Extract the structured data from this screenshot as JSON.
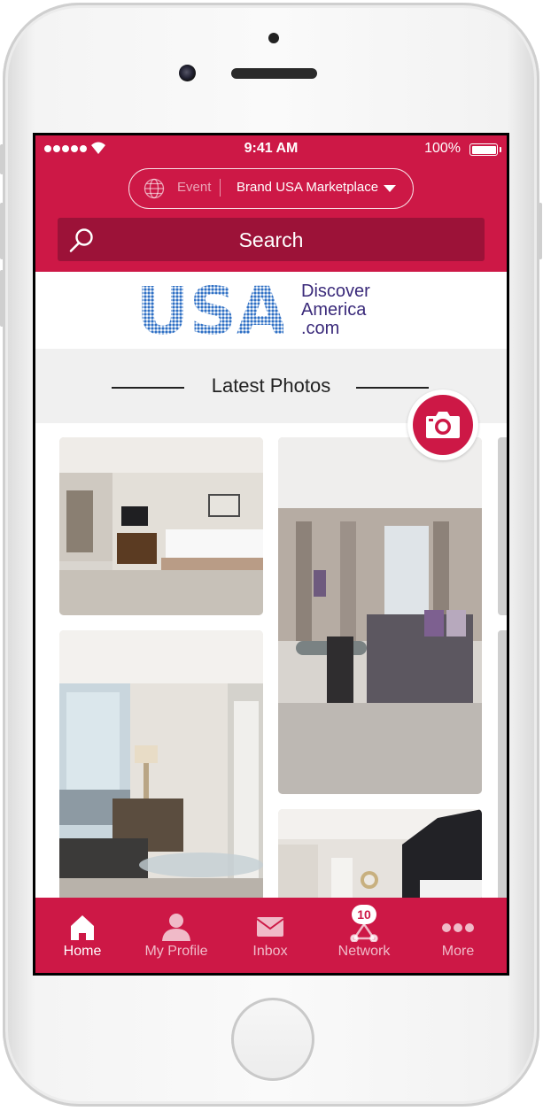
{
  "status_bar": {
    "time": "9:41 AM",
    "battery": "100%"
  },
  "event_selector": {
    "label": "Event",
    "value": "Brand USA Marketplace"
  },
  "search": {
    "label": "Search"
  },
  "banner": {
    "logo_text": "USA",
    "tagline_lines": [
      "Discover",
      "America",
      ".com"
    ]
  },
  "section": {
    "title": "Latest Photos"
  },
  "photos": [
    {
      "name": "hotel-room-bed"
    },
    {
      "name": "living-room-sofa"
    },
    {
      "name": "room-balcony-view"
    },
    {
      "name": "bedroom-headboard"
    }
  ],
  "tabs": [
    {
      "label": "Home",
      "icon": "home-icon",
      "active": true
    },
    {
      "label": "My Profile",
      "icon": "profile-icon",
      "active": false
    },
    {
      "label": "Inbox",
      "icon": "mail-icon",
      "active": false
    },
    {
      "label": "Network",
      "icon": "network-icon",
      "active": false,
      "badge": "10"
    },
    {
      "label": "More",
      "icon": "more-icon",
      "active": false
    }
  ],
  "colors": {
    "brand": "#cd1846",
    "search_bg": "#9c1238",
    "logo_blue": "#3a2a7a"
  }
}
